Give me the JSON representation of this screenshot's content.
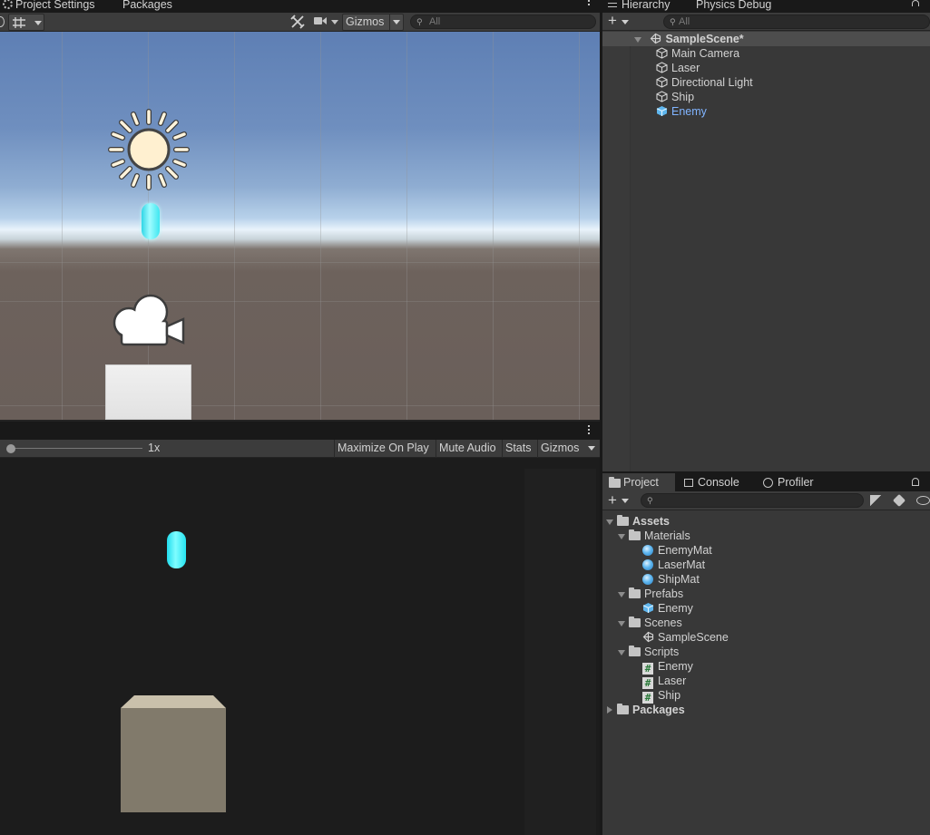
{
  "scene_tabs": {
    "project_settings": "Project Settings",
    "packages": "Packages"
  },
  "scene_toolbar": {
    "gizmos": "Gizmos",
    "search_placeholder": "All"
  },
  "game_toolbar": {
    "scale_label": "1x",
    "scale_value": 0,
    "maximize": "Maximize On Play",
    "mute": "Mute Audio",
    "stats": "Stats",
    "gizmos": "Gizmos"
  },
  "hierarchy": {
    "tabs": [
      "Hierarchy",
      "Physics Debug"
    ],
    "search_placeholder": "All",
    "scene": "SampleScene*",
    "items": [
      "Main Camera",
      "Laser",
      "Directional Light",
      "Ship",
      "Enemy"
    ],
    "selected": "Enemy"
  },
  "project": {
    "tabs": [
      "Project",
      "Console",
      "Profiler"
    ],
    "search_placeholder": "",
    "assets": "Assets",
    "materials": {
      "label": "Materials",
      "items": [
        "EnemyMat",
        "LaserMat",
        "ShipMat"
      ]
    },
    "prefabs": {
      "label": "Prefabs",
      "items": [
        "Enemy"
      ]
    },
    "scenes": {
      "label": "Scenes",
      "items": [
        "SampleScene"
      ]
    },
    "scripts": {
      "label": "Scripts",
      "items": [
        "Enemy",
        "Laser",
        "Ship"
      ]
    },
    "packages": "Packages"
  },
  "colors": {
    "selected_text": "#80b4ff",
    "laser": "#3ff4ff",
    "enemy_cube_game": "#817a6b",
    "panel_bg": "#383838"
  },
  "icons": [
    "gear-icon",
    "grid-snap-icon",
    "tools-icon",
    "camera-icon",
    "search-icon",
    "unity-scene-icon",
    "gameobject-icon",
    "prefab-icon",
    "folder-icon",
    "material-icon",
    "script-icon",
    "lock-icon",
    "plus-icon",
    "light-gizmo-icon",
    "camera-gizmo-icon"
  ]
}
